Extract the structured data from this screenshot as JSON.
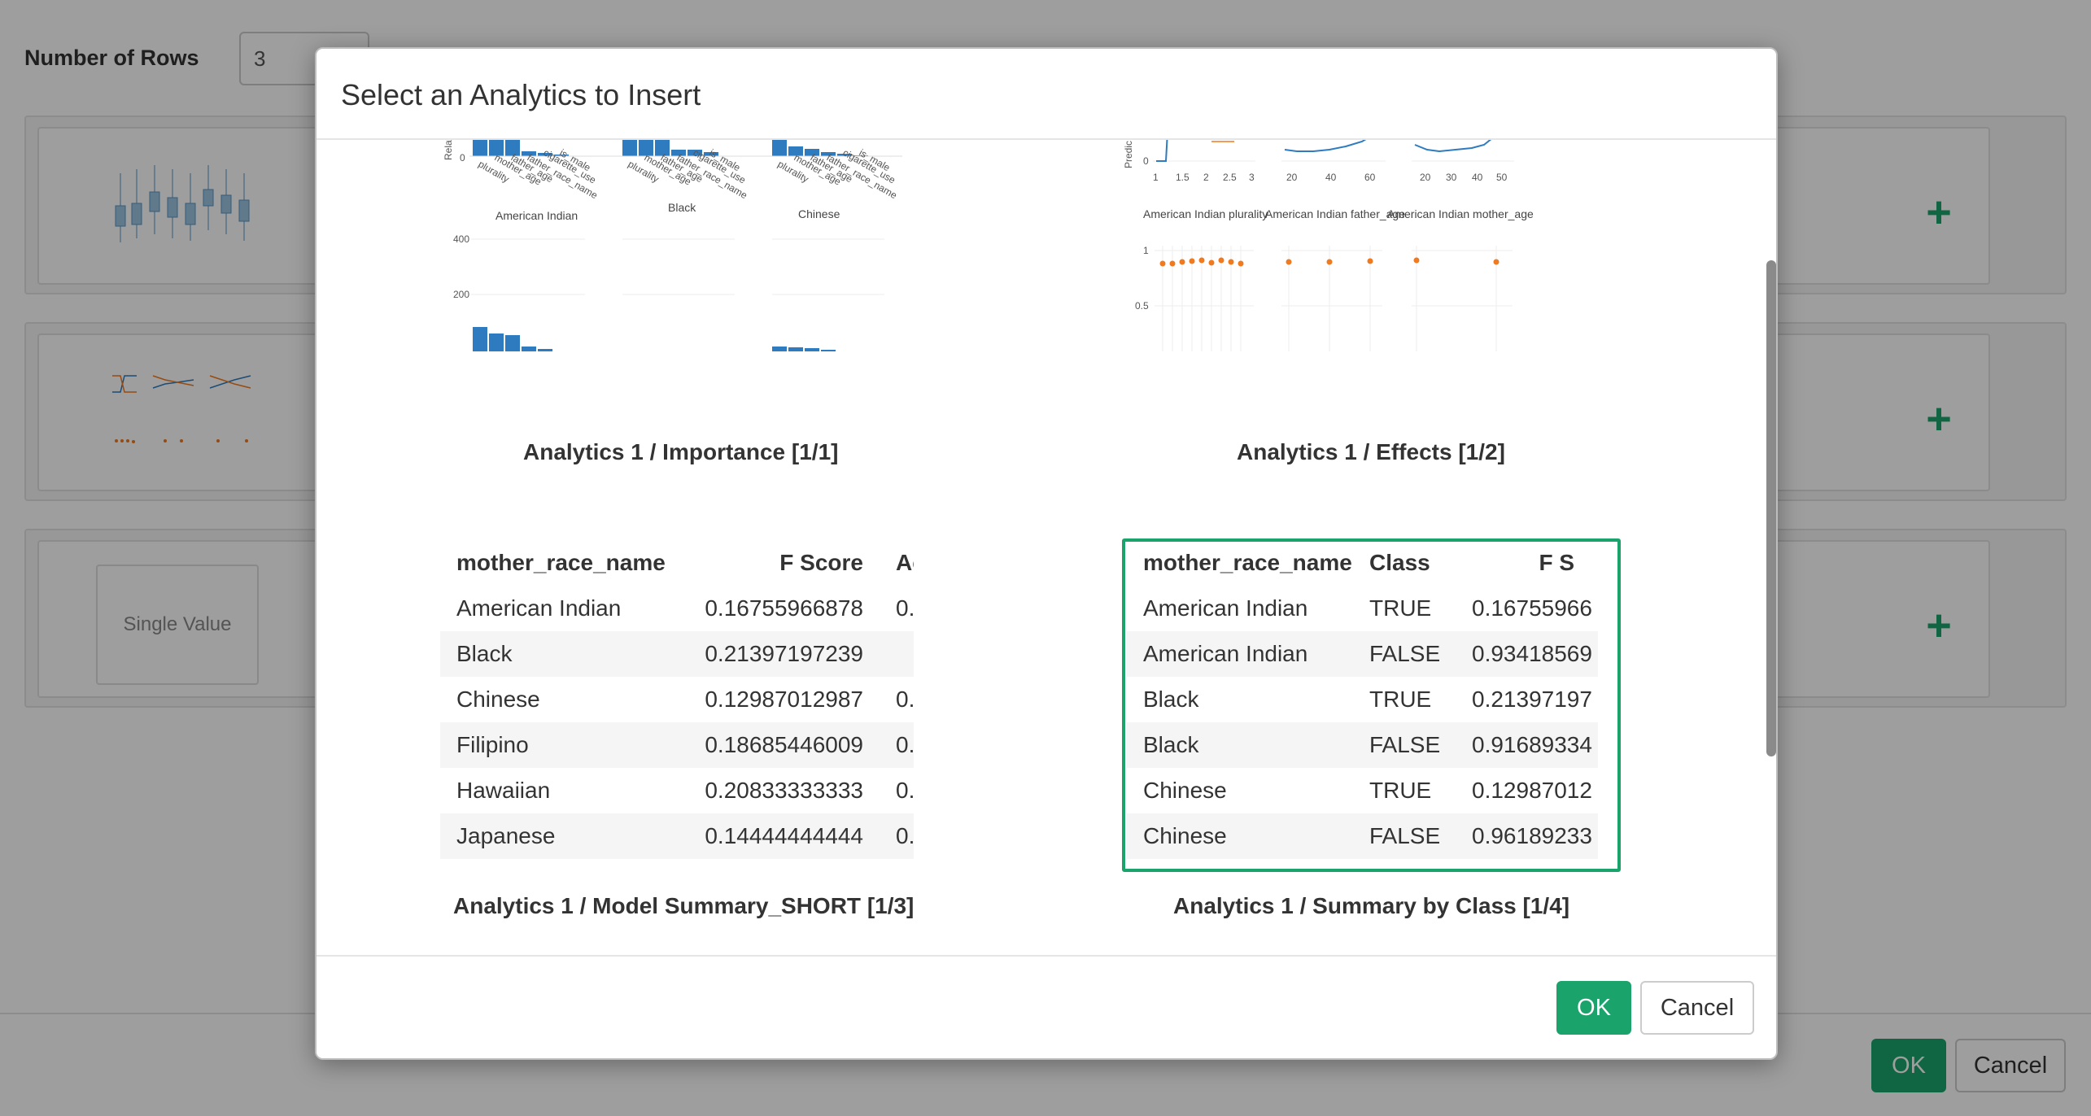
{
  "background": {
    "rows_label": "Number of Rows",
    "rows_value": "3",
    "single_value_label": "Single Value",
    "ok_label": "OK",
    "cancel_label": "Cancel"
  },
  "modal": {
    "title": "Select an Analytics to Insert",
    "ok_label": "OK",
    "cancel_label": "Cancel",
    "items": [
      {
        "label": "Analytics 1 / Importance [1/1]"
      },
      {
        "label": "Analytics 1 / Effects [1/2]"
      },
      {
        "label": "Analytics 1 / Model Summary_SHORT [1/3]"
      },
      {
        "label": "Analytics 1 / Summary by Class [1/4]"
      }
    ]
  },
  "importance_chart": {
    "panels": [
      "American Indian",
      "Black",
      "Chinese"
    ],
    "bar_labels": [
      "plurality",
      "mother_age",
      "father_age",
      "father_race_name",
      "cigarette_use",
      "is_male"
    ],
    "y_label_partial": "Relati",
    "y_ticks_lower": [
      "400",
      "200"
    ],
    "y_tick_upper": "0"
  },
  "effects_chart": {
    "y_label_partial": "Predic",
    "panel_labels": [
      "American Indian plurality",
      "American Indian father_age",
      "American Indian mother_age"
    ],
    "x_ticks": [
      [
        "1",
        "1.5",
        "2",
        "2.5",
        "3"
      ],
      [
        "20",
        "40",
        "60"
      ],
      [
        "20",
        "30",
        "40",
        "50"
      ]
    ],
    "y_tick_upper": "0",
    "y_ticks_lower": [
      "1",
      "0.5"
    ],
    "colors": {
      "line": "#2e7bbf",
      "point": "#f07a1f"
    }
  },
  "model_summary_table": {
    "headers": [
      "mother_race_name",
      "F Score",
      "Ac"
    ],
    "rows": [
      [
        "American Indian",
        "0.16755966878",
        "0."
      ],
      [
        "Black",
        "0.21397197239",
        ""
      ],
      [
        "Chinese",
        "0.12987012987",
        "0."
      ],
      [
        "Filipino",
        "0.18685446009",
        "0."
      ],
      [
        "Hawaiian",
        "0.20833333333",
        "0."
      ],
      [
        "Japanese",
        "0.14444444444",
        "0."
      ]
    ]
  },
  "class_summary_table": {
    "headers": [
      "mother_race_name",
      "Class",
      "F S"
    ],
    "rows": [
      [
        "American Indian",
        "TRUE",
        "0.16755966"
      ],
      [
        "American Indian",
        "FALSE",
        "0.93418569"
      ],
      [
        "Black",
        "TRUE",
        "0.21397197"
      ],
      [
        "Black",
        "FALSE",
        "0.91689334"
      ],
      [
        "Chinese",
        "TRUE",
        "0.12987012"
      ],
      [
        "Chinese",
        "FALSE",
        "0.96189233"
      ]
    ]
  },
  "colors": {
    "accent": "#1aa36b",
    "bar": "#2e7bbf"
  }
}
